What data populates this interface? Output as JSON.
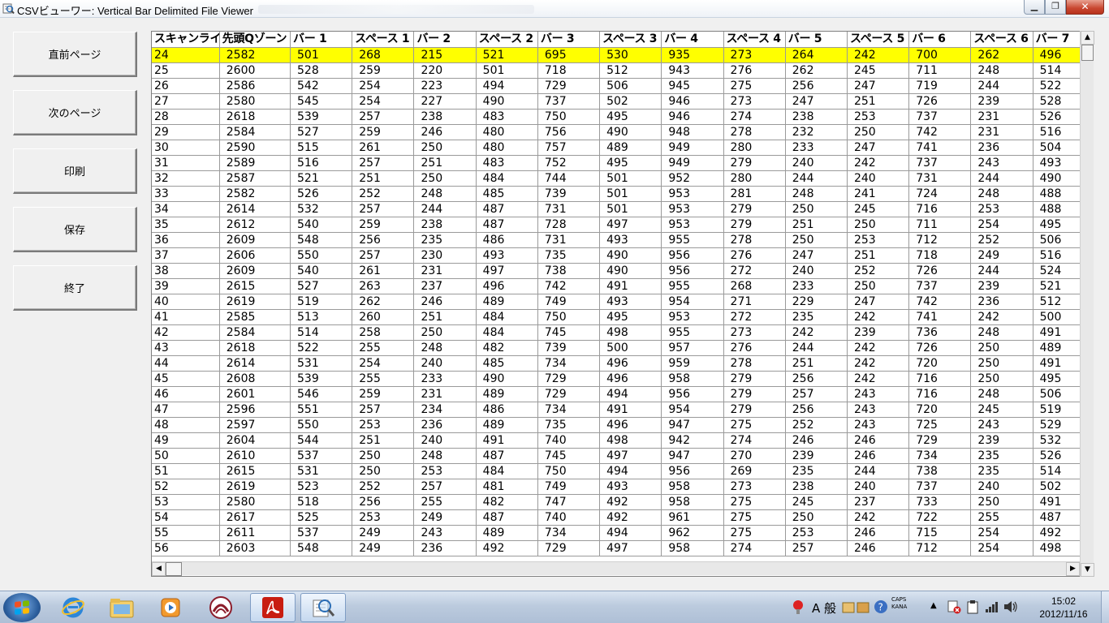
{
  "window": {
    "title": "CSVビューワー: Vertical Bar Delimited File Viewer",
    "minimize_glyph": "▁",
    "maximize_glyph": "❐",
    "close_glyph": "✕"
  },
  "sidebar": {
    "buttons": [
      {
        "label": "直前ページ"
      },
      {
        "label": "次のページ"
      },
      {
        "label": "印刷"
      },
      {
        "label": "保存"
      },
      {
        "label": "終了"
      }
    ]
  },
  "grid": {
    "columns": [
      "スキャンライン",
      "先頭Qゾーン",
      "バー 1",
      "スペース 1",
      "バー 2",
      "スペース 2",
      "バー 3",
      "スペース 3",
      "バー 4",
      "スペース 4",
      "バー 5",
      "スペース 5",
      "バー 6",
      "スペース 6",
      "バー 7"
    ],
    "selected_row": 0,
    "rows": [
      [
        "24",
        "2582",
        "501",
        "268",
        "215",
        "521",
        "695",
        "530",
        "935",
        "273",
        "264",
        "242",
        "700",
        "262",
        "496"
      ],
      [
        "25",
        "2600",
        "528",
        "259",
        "220",
        "501",
        "718",
        "512",
        "943",
        "276",
        "262",
        "245",
        "711",
        "248",
        "514"
      ],
      [
        "26",
        "2586",
        "542",
        "254",
        "223",
        "494",
        "729",
        "506",
        "945",
        "275",
        "256",
        "247",
        "719",
        "244",
        "522"
      ],
      [
        "27",
        "2580",
        "545",
        "254",
        "227",
        "490",
        "737",
        "502",
        "946",
        "273",
        "247",
        "251",
        "726",
        "239",
        "528"
      ],
      [
        "28",
        "2618",
        "539",
        "257",
        "238",
        "483",
        "750",
        "495",
        "946",
        "274",
        "238",
        "253",
        "737",
        "231",
        "526"
      ],
      [
        "29",
        "2584",
        "527",
        "259",
        "246",
        "480",
        "756",
        "490",
        "948",
        "278",
        "232",
        "250",
        "742",
        "231",
        "516"
      ],
      [
        "30",
        "2590",
        "515",
        "261",
        "250",
        "480",
        "757",
        "489",
        "949",
        "280",
        "233",
        "247",
        "741",
        "236",
        "504"
      ],
      [
        "31",
        "2589",
        "516",
        "257",
        "251",
        "483",
        "752",
        "495",
        "949",
        "279",
        "240",
        "242",
        "737",
        "243",
        "493"
      ],
      [
        "32",
        "2587",
        "521",
        "251",
        "250",
        "484",
        "744",
        "501",
        "952",
        "280",
        "244",
        "240",
        "731",
        "244",
        "490"
      ],
      [
        "33",
        "2582",
        "526",
        "252",
        "248",
        "485",
        "739",
        "501",
        "953",
        "281",
        "248",
        "241",
        "724",
        "248",
        "488"
      ],
      [
        "34",
        "2614",
        "532",
        "257",
        "244",
        "487",
        "731",
        "501",
        "953",
        "279",
        "250",
        "245",
        "716",
        "253",
        "488"
      ],
      [
        "35",
        "2612",
        "540",
        "259",
        "238",
        "487",
        "728",
        "497",
        "953",
        "279",
        "251",
        "250",
        "711",
        "254",
        "495"
      ],
      [
        "36",
        "2609",
        "548",
        "256",
        "235",
        "486",
        "731",
        "493",
        "955",
        "278",
        "250",
        "253",
        "712",
        "252",
        "506"
      ],
      [
        "37",
        "2606",
        "550",
        "257",
        "230",
        "493",
        "735",
        "490",
        "956",
        "276",
        "247",
        "251",
        "718",
        "249",
        "516"
      ],
      [
        "38",
        "2609",
        "540",
        "261",
        "231",
        "497",
        "738",
        "490",
        "956",
        "272",
        "240",
        "252",
        "726",
        "244",
        "524"
      ],
      [
        "39",
        "2615",
        "527",
        "263",
        "237",
        "496",
        "742",
        "491",
        "955",
        "268",
        "233",
        "250",
        "737",
        "239",
        "521"
      ],
      [
        "40",
        "2619",
        "519",
        "262",
        "246",
        "489",
        "749",
        "493",
        "954",
        "271",
        "229",
        "247",
        "742",
        "236",
        "512"
      ],
      [
        "41",
        "2585",
        "513",
        "260",
        "251",
        "484",
        "750",
        "495",
        "953",
        "272",
        "235",
        "242",
        "741",
        "242",
        "500"
      ],
      [
        "42",
        "2584",
        "514",
        "258",
        "250",
        "484",
        "745",
        "498",
        "955",
        "273",
        "242",
        "239",
        "736",
        "248",
        "491"
      ],
      [
        "43",
        "2618",
        "522",
        "255",
        "248",
        "482",
        "739",
        "500",
        "957",
        "276",
        "244",
        "242",
        "726",
        "250",
        "489"
      ],
      [
        "44",
        "2614",
        "531",
        "254",
        "240",
        "485",
        "734",
        "496",
        "959",
        "278",
        "251",
        "242",
        "720",
        "250",
        "491"
      ],
      [
        "45",
        "2608",
        "539",
        "255",
        "233",
        "490",
        "729",
        "496",
        "958",
        "279",
        "256",
        "242",
        "716",
        "250",
        "495"
      ],
      [
        "46",
        "2601",
        "546",
        "259",
        "231",
        "489",
        "729",
        "494",
        "956",
        "279",
        "257",
        "243",
        "716",
        "248",
        "506"
      ],
      [
        "47",
        "2596",
        "551",
        "257",
        "234",
        "486",
        "734",
        "491",
        "954",
        "279",
        "256",
        "243",
        "720",
        "245",
        "519"
      ],
      [
        "48",
        "2597",
        "550",
        "253",
        "236",
        "489",
        "735",
        "496",
        "947",
        "275",
        "252",
        "243",
        "725",
        "243",
        "529"
      ],
      [
        "49",
        "2604",
        "544",
        "251",
        "240",
        "491",
        "740",
        "498",
        "942",
        "274",
        "246",
        "246",
        "729",
        "239",
        "532"
      ],
      [
        "50",
        "2610",
        "537",
        "250",
        "248",
        "487",
        "745",
        "497",
        "947",
        "270",
        "239",
        "246",
        "734",
        "235",
        "526"
      ],
      [
        "51",
        "2615",
        "531",
        "250",
        "253",
        "484",
        "750",
        "494",
        "956",
        "269",
        "235",
        "244",
        "738",
        "235",
        "514"
      ],
      [
        "52",
        "2619",
        "523",
        "252",
        "257",
        "481",
        "749",
        "493",
        "958",
        "273",
        "238",
        "240",
        "737",
        "240",
        "502"
      ],
      [
        "53",
        "2580",
        "518",
        "256",
        "255",
        "482",
        "747",
        "492",
        "958",
        "275",
        "245",
        "237",
        "733",
        "250",
        "491"
      ],
      [
        "54",
        "2617",
        "525",
        "253",
        "249",
        "487",
        "740",
        "492",
        "961",
        "275",
        "250",
        "242",
        "722",
        "255",
        "487"
      ],
      [
        "55",
        "2611",
        "537",
        "249",
        "243",
        "489",
        "734",
        "494",
        "962",
        "275",
        "253",
        "246",
        "715",
        "254",
        "492"
      ],
      [
        "56",
        "2603",
        "548",
        "249",
        "236",
        "492",
        "729",
        "497",
        "958",
        "274",
        "257",
        "246",
        "712",
        "254",
        "498"
      ]
    ]
  },
  "scrollbars": {
    "up_glyph": "▲",
    "down_glyph": "▼",
    "left_glyph": "◀",
    "right_glyph": "▶"
  },
  "taskbar": {
    "ime_mode": "A 般",
    "caps": "CAPS",
    "kana": "KANA",
    "time": "15:02",
    "date": "2012/11/16"
  },
  "colors": {
    "selected_row": "#ffff00",
    "close_button": "#c84630",
    "taskbar": "#bccbde"
  }
}
